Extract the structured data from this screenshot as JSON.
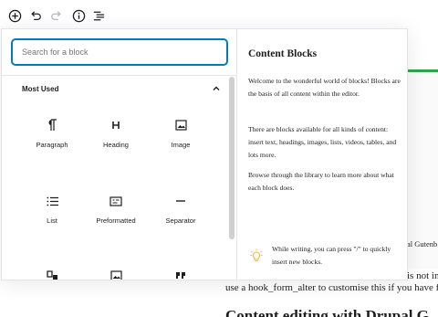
{
  "toolbar": {
    "add_block_icon": "plus-circle-icon",
    "undo_icon": "undo-icon",
    "redo_icon": "redo-icon",
    "info_icon": "info-icon",
    "outline_icon": "list-view-icon"
  },
  "inserter": {
    "search_placeholder": "Search for a block",
    "section_title": "Most Used",
    "blocks": [
      {
        "label": "Paragraph",
        "icon": "paragraph-icon"
      },
      {
        "label": "Heading",
        "icon": "heading-icon"
      },
      {
        "label": "Image",
        "icon": "image-icon"
      },
      {
        "label": "List",
        "icon": "list-icon"
      },
      {
        "label": "Preformatted",
        "icon": "preformatted-icon"
      },
      {
        "label": "Separator",
        "icon": "separator-icon"
      },
      {
        "label": "",
        "icon": "shortcode-icon"
      },
      {
        "label": "",
        "icon": "gallery-icon"
      },
      {
        "label": "",
        "icon": "quote-icon"
      }
    ]
  },
  "preview": {
    "title": "Content Blocks",
    "paragraphs": [
      "Welcome to the wonderful world of blocks! Blocks are the basis of all content within the editor.",
      "There are blocks available for all kinds of content: insert text, headings, images, lists, videos, tables, and lots more.",
      "Browse through the library to learn more about what each block does."
    ],
    "tip": "While writing, you can press \"/\" to quickly insert new blocks.",
    "tip_icon": "lightbulb-icon"
  },
  "background": {
    "line1": "is not in",
    "line2": "use a hook_form_alter to customise this if you have field",
    "heading": "Content editing with Drupal G",
    "side_text": "al Gutenb"
  },
  "colors": {
    "accent": "#007cba",
    "border": "#e2e4e7",
    "tip": "#f0b849"
  }
}
